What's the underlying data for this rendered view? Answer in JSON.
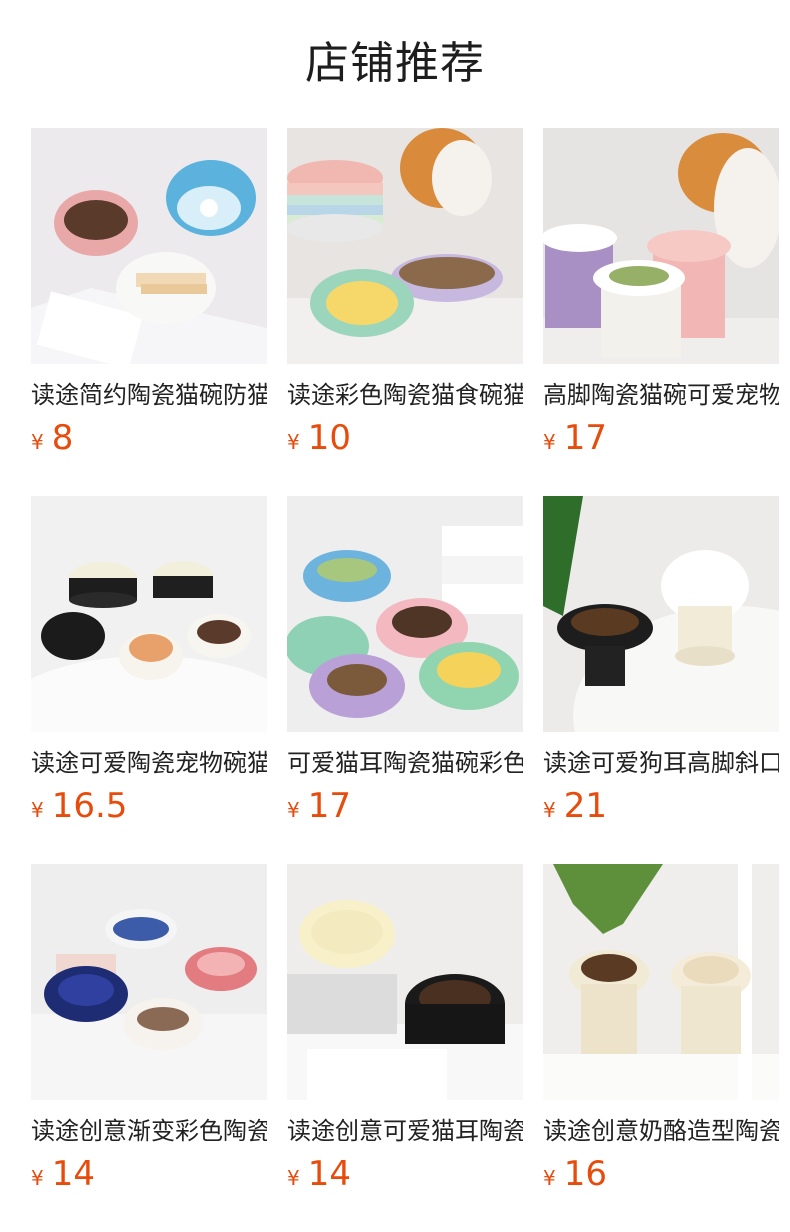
{
  "header": {
    "title": "店铺推荐"
  },
  "currency_symbol": "¥",
  "colors": {
    "price": "#e84c0c",
    "title": "#222222"
  },
  "products": [
    {
      "title": "读途简约陶瓷猫碗防猫",
      "price": "8",
      "image": "ceramic-cat-bowls-pink-blue-white"
    },
    {
      "title": "读途彩色陶瓷猫食碗猫",
      "price": "10",
      "image": "colorful-ceramic-cat-bowls-with-cat"
    },
    {
      "title": "高脚陶瓷猫碗可爱宠物",
      "price": "17",
      "image": "tall-ceramic-cat-bowls-with-cat"
    },
    {
      "title": "读途可爱陶瓷宠物碗猫",
      "price": "16.5",
      "image": "cute-ceramic-pet-bowls-black-white"
    },
    {
      "title": "可爱猫耳陶瓷猫碗彩色",
      "price": "17",
      "image": "cat-ear-ceramic-bowls-colorful"
    },
    {
      "title": "读途可爱狗耳高脚斜口",
      "price": "21",
      "image": "dog-ear-tall-bowl-black-white"
    },
    {
      "title": "读途创意渐变彩色陶瓷",
      "price": "14",
      "image": "gradient-slow-feeder-bowls"
    },
    {
      "title": "读途创意可爱猫耳陶瓷",
      "price": "14",
      "image": "cat-ear-bowls-cream-black"
    },
    {
      "title": "读途创意奶酪造型陶瓷",
      "price": "16",
      "image": "cheese-shaped-tall-bowls"
    }
  ]
}
